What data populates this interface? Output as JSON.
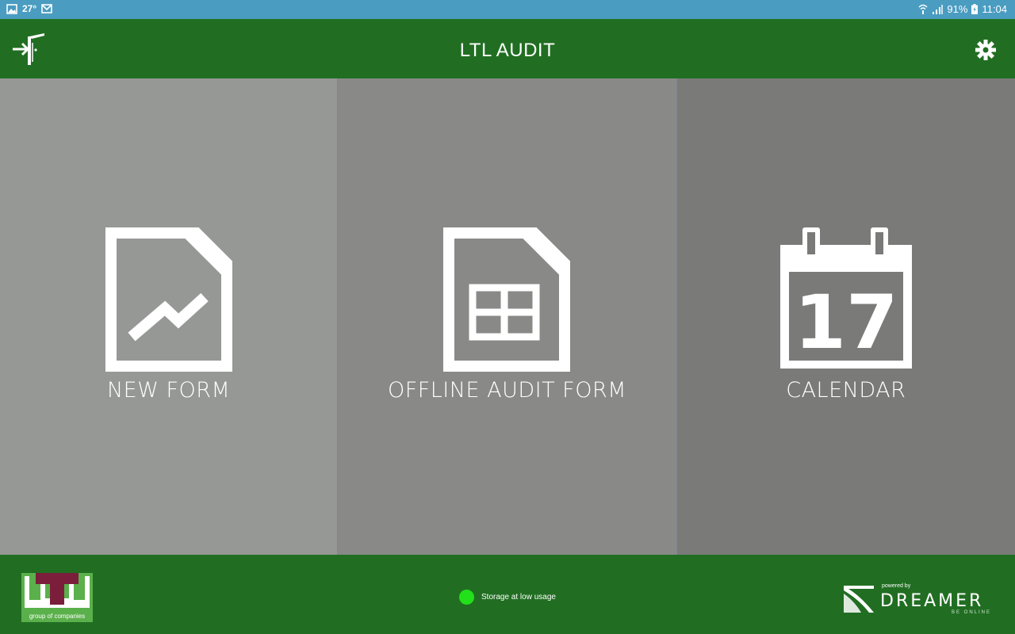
{
  "status_bar": {
    "temperature": "27°",
    "battery": "91%",
    "time": "11:04"
  },
  "app_bar": {
    "title": "LTL AUDIT",
    "logout_icon": "logout-icon",
    "settings_icon": "gear-icon"
  },
  "tiles": [
    {
      "label": "NEW FORM",
      "icon": "new-form-icon"
    },
    {
      "label": "OFFLINE AUDIT FORM",
      "icon": "offline-audit-form-icon"
    },
    {
      "label": "CALENDAR",
      "icon": "calendar-icon",
      "calendar_day": "17"
    }
  ],
  "footer": {
    "logo_text": "group of companies",
    "storage_status": "Storage at low usage",
    "storage_color": "#22e019",
    "powered_by": "powered by",
    "brand": "DREAMER",
    "tagline": "BE ONLINE"
  },
  "colors": {
    "app_bar": "#216e22",
    "status_bar": "#4a9cc1"
  }
}
